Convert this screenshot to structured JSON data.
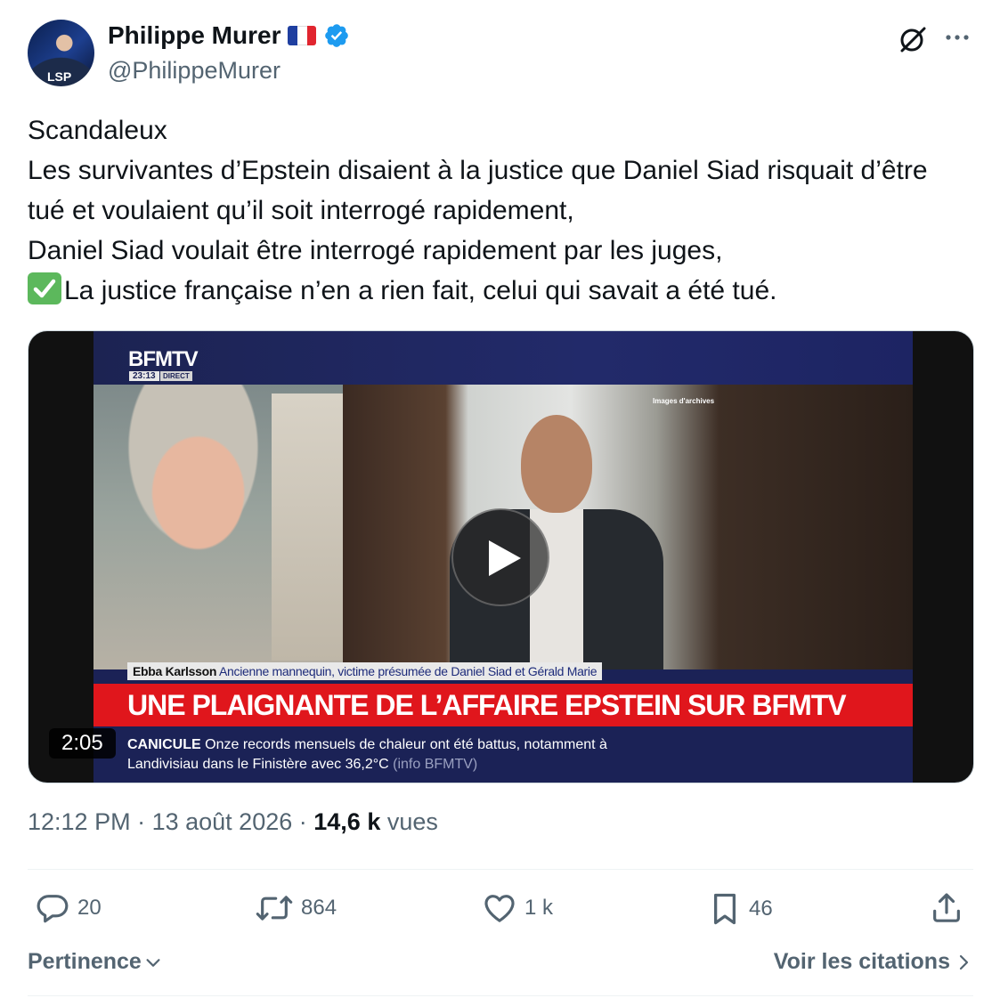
{
  "author": {
    "name": "Philippe Murer",
    "flag": "🇫🇷",
    "handle": "@PhilippeMurer",
    "avatar_text": "LSP"
  },
  "tweet": {
    "lines": [
      "Scandaleux",
      "Les survivantes d’Epstein disaient à la justice que Daniel Siad risquait d’être tué et voulaient qu’il soit interrogé rapidement,",
      "Daniel Siad voulait être interrogé rapidement par les juges,",
      "La justice française n’en a rien fait, celui qui savait a été tué."
    ],
    "last_line_emoji": "check-mark-button-emoji"
  },
  "video": {
    "channel_logo": "BFMTV",
    "time": "23:13",
    "live_label": "DIRECT",
    "archive_label": "Images d'archives",
    "caption_name": "Ebba Karlsson",
    "caption_role": "Ancienne mannequin, victime présumée de Daniel Siad et Gérald Marie",
    "headline": "UNE PLAIGNANTE DE L’AFFAIRE EPSTEIN SUR BFMTV",
    "ticker_label": "CANICULE",
    "ticker_line1": "Onze records mensuels de chaleur ont été battus, notamment à",
    "ticker_line2": "Landivisiau dans le Finistère avec 36,2°C",
    "ticker_source": "(info BFMTV)",
    "duration": "2:05"
  },
  "meta": {
    "time": "12:12 PM",
    "date": "13 août 2026",
    "views_count": "14,6 k",
    "views_label": "vues"
  },
  "actions": {
    "replies": "20",
    "reposts": "864",
    "likes": "1 k",
    "bookmarks": "46"
  },
  "footer": {
    "sort_label": "Pertinence",
    "quotes_label": "Voir les citations"
  },
  "colors": {
    "verified": "#1d9bf0",
    "text_primary": "#0f1419",
    "text_secondary": "#536471",
    "bfm_blue": "#1b2256",
    "bfm_red": "#e0161c"
  }
}
